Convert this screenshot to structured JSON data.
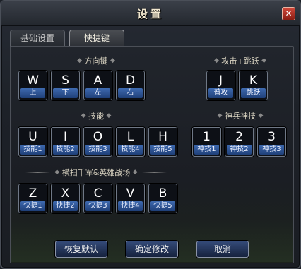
{
  "window": {
    "title": "设置",
    "close_label": "✕"
  },
  "tabs": [
    {
      "label": "基础设置",
      "active": false
    },
    {
      "label": "快捷键",
      "active": true
    }
  ],
  "sections": {
    "direction": "方向键",
    "attack_jump": "攻击+跳跃",
    "skills": "技能",
    "divine_skills": "神兵神技",
    "battlefield": "横扫千军&英雄战场"
  },
  "keys": {
    "direction": [
      {
        "key": "W",
        "func": "上"
      },
      {
        "key": "S",
        "func": "下"
      },
      {
        "key": "A",
        "func": "左"
      },
      {
        "key": "D",
        "func": "右"
      }
    ],
    "attack_jump": [
      {
        "key": "J",
        "func": "普攻"
      },
      {
        "key": "K",
        "func": "跳跃"
      }
    ],
    "skills": [
      {
        "key": "U",
        "func": "技能1"
      },
      {
        "key": "I",
        "func": "技能2"
      },
      {
        "key": "O",
        "func": "技能3"
      },
      {
        "key": "L",
        "func": "技能4"
      },
      {
        "key": "H",
        "func": "技能5"
      }
    ],
    "divine_skills": [
      {
        "key": "1",
        "func": "神技1"
      },
      {
        "key": "2",
        "func": "神技2"
      },
      {
        "key": "3",
        "func": "神技3"
      }
    ],
    "battlefield": [
      {
        "key": "Z",
        "func": "快捷1"
      },
      {
        "key": "X",
        "func": "快捷2"
      },
      {
        "key": "C",
        "func": "快捷3"
      },
      {
        "key": "V",
        "func": "快捷4"
      },
      {
        "key": "B",
        "func": "快捷5"
      }
    ]
  },
  "buttons": {
    "restore_default": "恢复默认",
    "confirm": "确定修改",
    "cancel": "取消"
  }
}
